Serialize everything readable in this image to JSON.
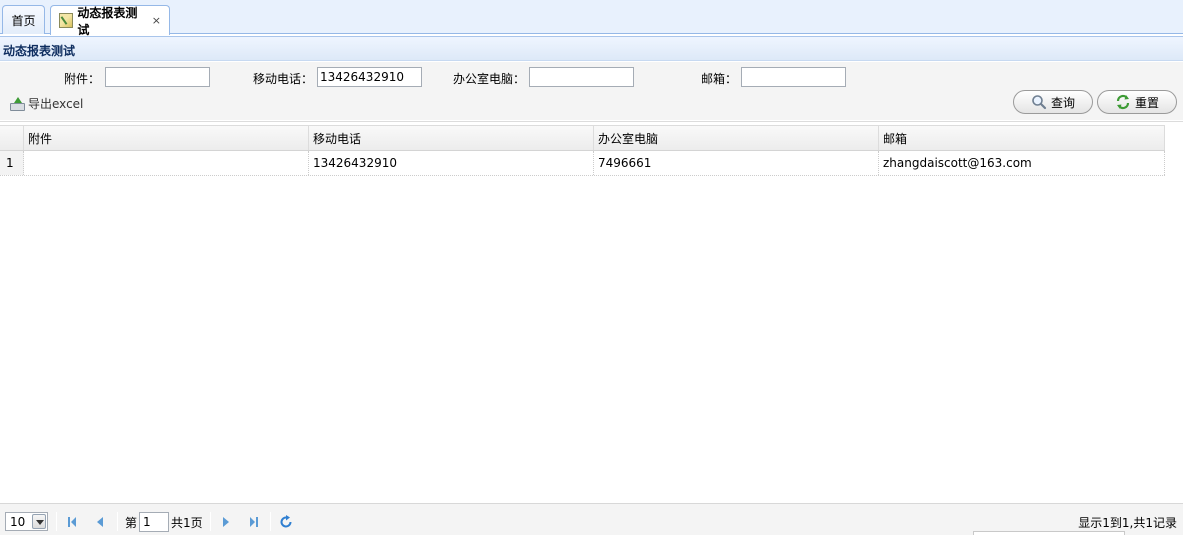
{
  "tabs": [
    {
      "label": "首页",
      "active": false
    },
    {
      "label": "动态报表测试",
      "active": true,
      "close": "×"
    }
  ],
  "panel": {
    "title": "动态报表测试"
  },
  "form": {
    "fields": [
      {
        "label": "附件：",
        "value": ""
      },
      {
        "label": "移动电话：",
        "value": "13426432910"
      },
      {
        "label": "办公室电脑：",
        "value": ""
      },
      {
        "label": "邮箱：",
        "value": ""
      }
    ],
    "export_label": "导出excel",
    "search_label": "查询",
    "reset_label": "重置"
  },
  "grid": {
    "columns": [
      "附件",
      "移动电话",
      "办公室电脑",
      "邮箱"
    ],
    "rows": [
      {
        "num": "1",
        "cells": [
          "",
          "13426432910",
          "7496661",
          "zhangdaiscott@163.com"
        ]
      }
    ]
  },
  "pager": {
    "page_size": "10",
    "page_prefix": "第",
    "page_value": "1",
    "page_total": "共1页",
    "info": "显示1到1,共1记录"
  },
  "colors": {
    "accent": "#95b8e7",
    "panel_title": "#0e2d5f",
    "nav_icon": "#5b9bd5"
  }
}
